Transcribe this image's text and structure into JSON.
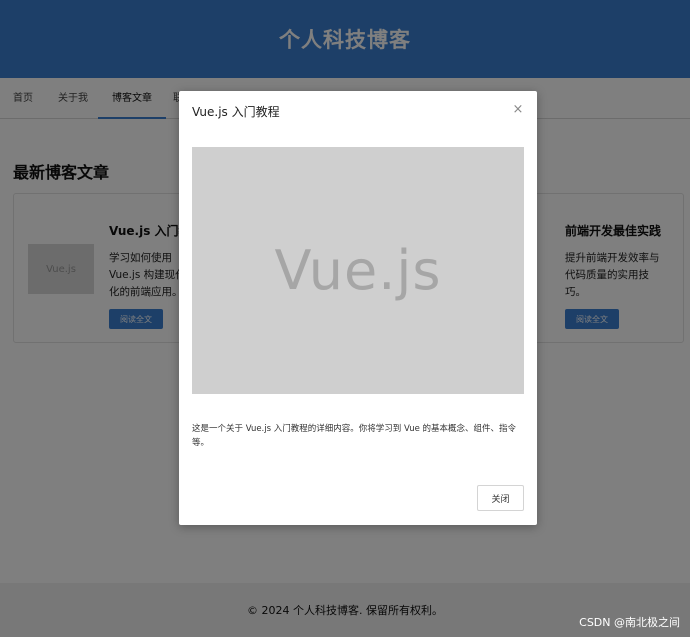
{
  "header": {
    "title": "个人科技博客"
  },
  "nav": {
    "tabs": [
      {
        "label": "首页"
      },
      {
        "label": "关于我"
      },
      {
        "label": "博客文章"
      },
      {
        "label": "联"
      }
    ],
    "active_index": 2
  },
  "main": {
    "section_title": "最新博客文章",
    "posts": [
      {
        "thumb_label": "Vue.js",
        "title": "Vue.js 入门教程",
        "description": "学习如何使用 Vue.js 构建现代化的前端应用。",
        "button_label": "阅读全文"
      },
      {
        "title": "前端开发最佳实践",
        "description": "提升前端开发效率与代码质量的实用技巧。",
        "button_label": "阅读全文"
      }
    ]
  },
  "footer": {
    "text": "© 2024 个人科技博客. 保留所有权利。"
  },
  "modal": {
    "title": "Vue.js 入门教程",
    "close_icon": "×",
    "image_label": "Vue.js",
    "description": "这是一个关于 Vue.js 入门教程的详细内容。你将学习到 Vue 的基本概念、组件、指令等。",
    "close_button_label": "关闭"
  },
  "watermark": "CSDN @南北极之间",
  "colors": {
    "primary": "#3a7fd0",
    "overlay": "rgba(0,0,0,0.5)",
    "footer_bg": "#f0f0f0"
  }
}
